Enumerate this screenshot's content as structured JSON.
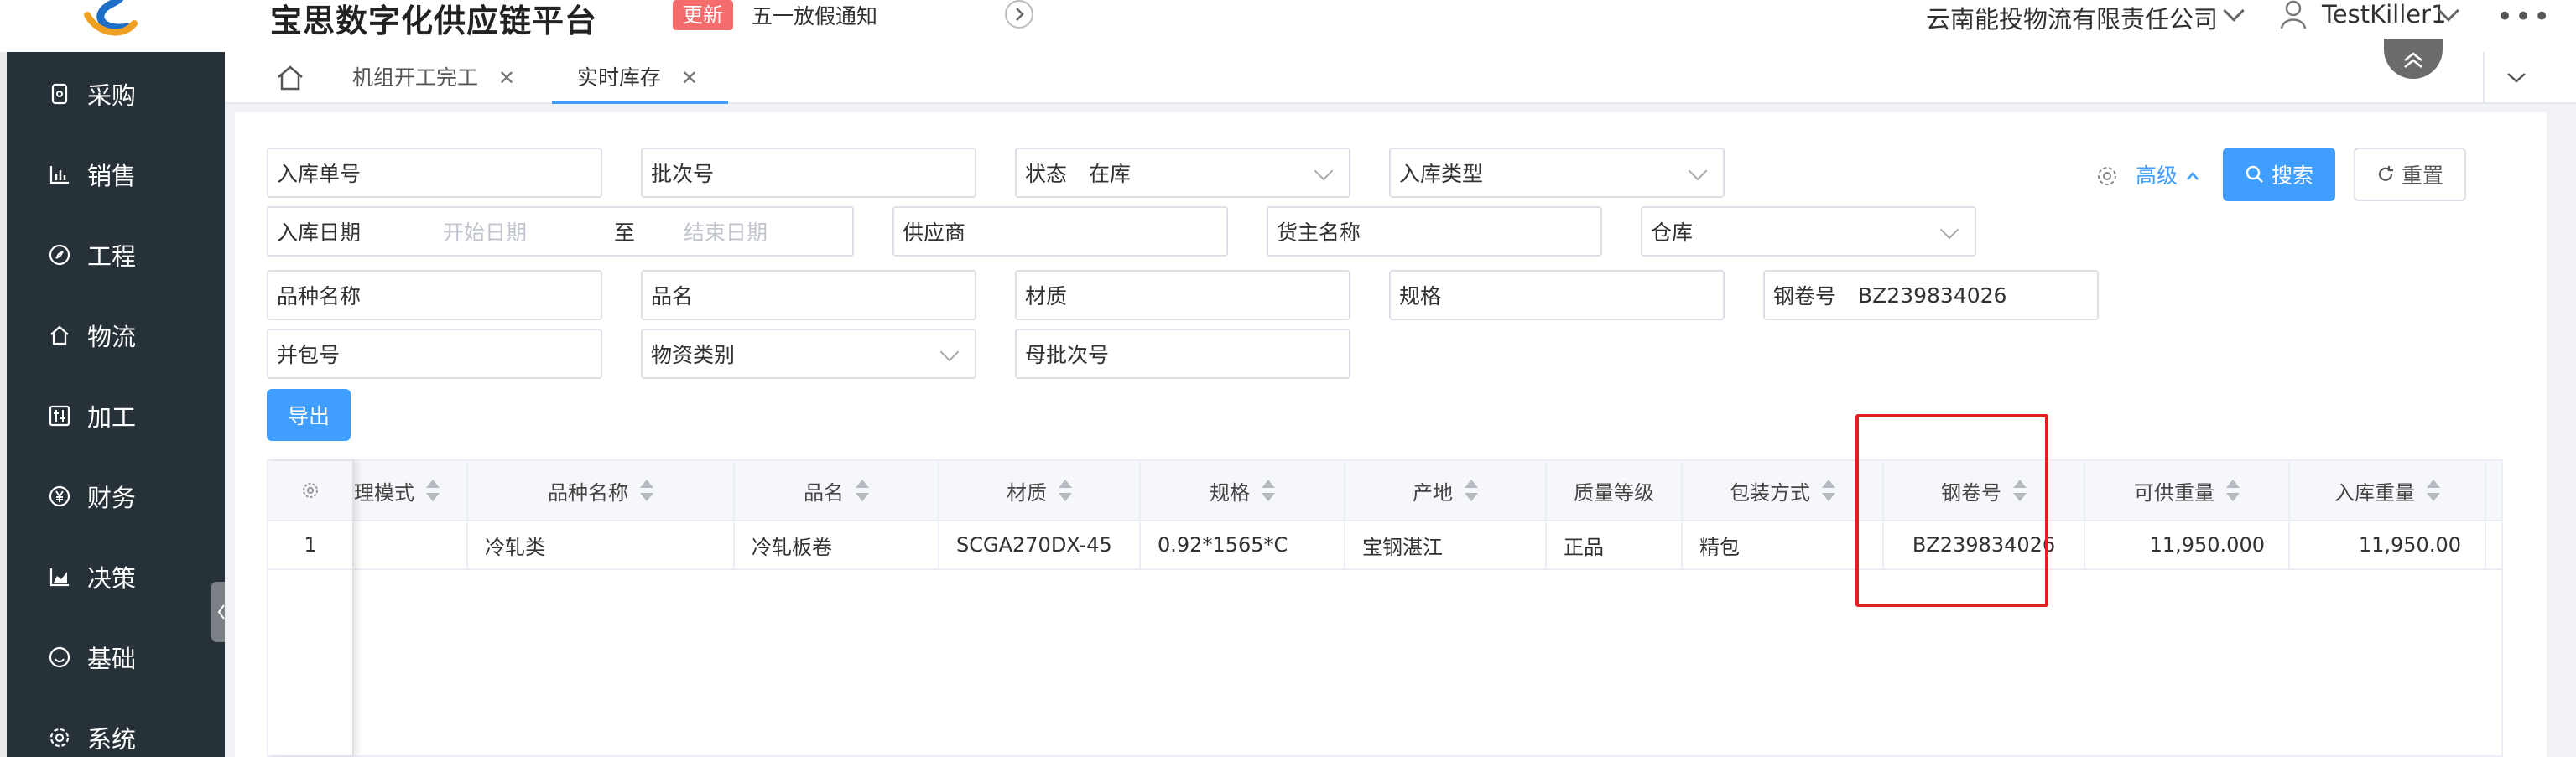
{
  "header": {
    "app_title": "宝思数字化供应链平台",
    "update_badge": "更新",
    "notice": "五一放假通知",
    "company": "云南能投物流有限责任公司",
    "username": "TestKiller1",
    "more": "•••"
  },
  "sidebar": {
    "items": [
      {
        "label": "采购",
        "icon": "receipt-icon"
      },
      {
        "label": "销售",
        "icon": "bar-chart-icon"
      },
      {
        "label": "工程",
        "icon": "compass-icon"
      },
      {
        "label": "物流",
        "icon": "home-icon"
      },
      {
        "label": "加工",
        "icon": "sliders-icon"
      },
      {
        "label": "财务",
        "icon": "yen-icon"
      },
      {
        "label": "决策",
        "icon": "area-chart-icon"
      },
      {
        "label": "基础",
        "icon": "smile-icon"
      },
      {
        "label": "系统",
        "icon": "gear-icon"
      }
    ]
  },
  "tabs": [
    {
      "label": "机组开工完工",
      "close": "✕"
    },
    {
      "label": "实时库存",
      "close": "✕"
    }
  ],
  "filters": {
    "inbound_no": "入库单号",
    "batch_no": "批次号",
    "status_label": "状态",
    "status_value": "在库",
    "inbound_type": "入库类型",
    "inbound_date": "入库日期",
    "start_date": "开始日期",
    "to": "至",
    "end_date": "结束日期",
    "supplier": "供应商",
    "owner_name": "货主名称",
    "warehouse": "仓库",
    "variety_name": "品种名称",
    "product_name": "品名",
    "material": "材质",
    "spec": "规格",
    "coil_label": "钢卷号",
    "coil_value": "BZ239834026",
    "package_no": "并包号",
    "material_category": "物资类别",
    "parent_batch_no": "母批次号"
  },
  "actions": {
    "advanced": "高级",
    "search": "搜索",
    "reset": "重置",
    "export": "导出"
  },
  "table": {
    "headers": [
      "理模式",
      "品种名称",
      "品名",
      "材质",
      "规格",
      "产地",
      "质量等级",
      "包装方式",
      "钢卷号",
      "可供重量",
      "入库重量"
    ],
    "rows": [
      {
        "index": "1",
        "mode": "",
        "variety": "冷轧类",
        "product": "冷轧板卷",
        "material": "SCGA270DX-45",
        "spec": "0.92*1565*C",
        "origin": "宝钢湛江",
        "grade": "正品",
        "packaging": "精包",
        "coil": "BZ239834026",
        "available_weight": "11,950.000",
        "inbound_weight": "11,950.00"
      }
    ]
  },
  "colors": {
    "sidebar_bg": "#263238",
    "primary": "#409eff",
    "badge": "#f56c6c",
    "highlight": "#e02020"
  }
}
